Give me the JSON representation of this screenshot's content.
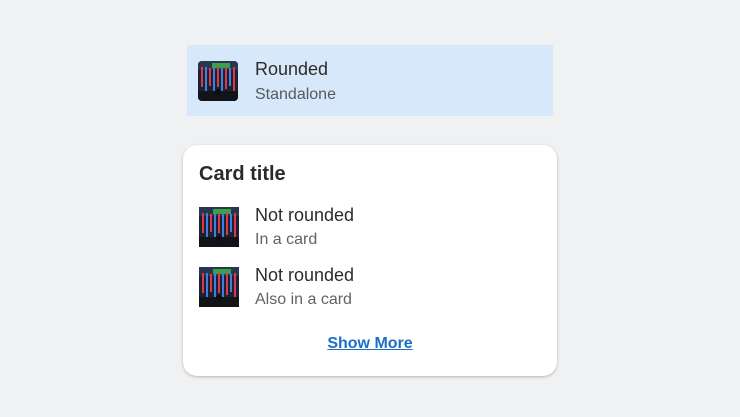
{
  "standalone": {
    "title": "Rounded",
    "subtitle": "Standalone",
    "thumbnail_icon": "concert-stage-image"
  },
  "card": {
    "title": "Card title",
    "items": [
      {
        "title": "Not rounded",
        "subtitle": "In a card",
        "thumbnail_icon": "concert-stage-image"
      },
      {
        "title": "Not rounded",
        "subtitle": "Also in a card",
        "thumbnail_icon": "concert-stage-image"
      }
    ],
    "show_more_label": "Show More"
  },
  "colors": {
    "page_background": "#eff1f3",
    "standalone_background": "#d7e8fb",
    "card_background": "#ffffff",
    "link": "#1a6fc9"
  }
}
